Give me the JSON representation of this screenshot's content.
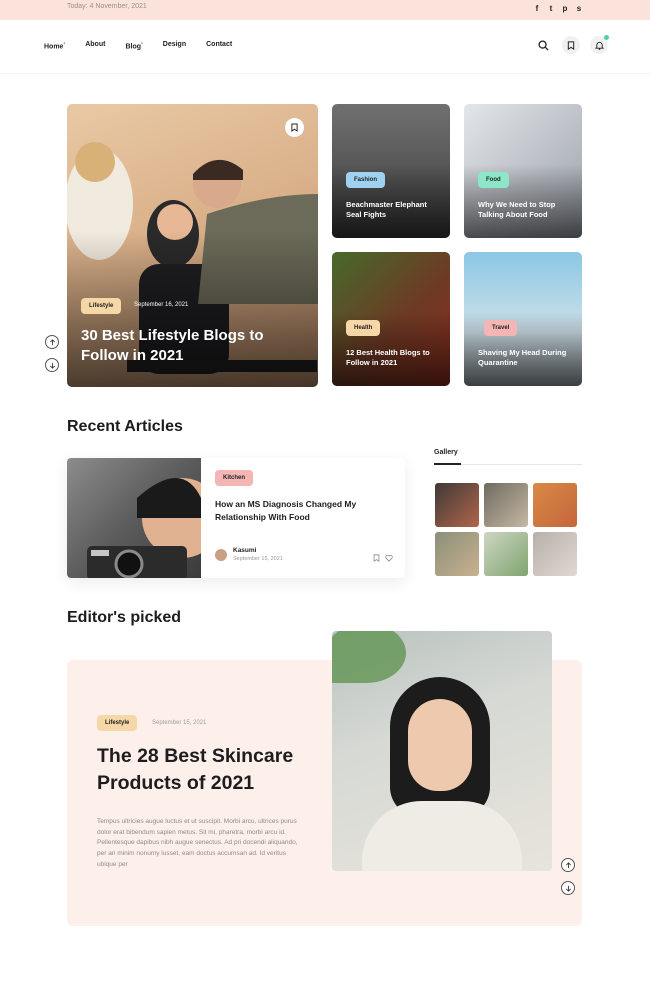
{
  "topbar": {
    "date": "Today: 4 November, 2021",
    "social": [
      "f",
      "t",
      "p",
      "s"
    ]
  },
  "nav": {
    "links": [
      {
        "label": "Home",
        "dropdown": true
      },
      {
        "label": "About",
        "dropdown": false
      },
      {
        "label": "Blog",
        "dropdown": true
      },
      {
        "label": "Design",
        "dropdown": false
      },
      {
        "label": "Contact",
        "dropdown": false
      }
    ],
    "tools": [
      "search-icon",
      "bookmark-icon",
      "bell-icon"
    ]
  },
  "hero": {
    "tag": "Lifestyle",
    "date": "September 16, 2021",
    "title": "30 Best Lifestyle Blogs to Follow in 2021"
  },
  "cards": [
    {
      "tag": "Fashion",
      "tag_color": "#9fd2f0",
      "title": "Beachmaster Elephant Seal Fights",
      "bg": [
        "#3e3e3e",
        "#6a6a6a"
      ]
    },
    {
      "tag": "Food",
      "tag_color": "#8ee6c9",
      "title": "Why We Need to Stop Talking About Food",
      "bg": [
        "#d9dde3",
        "#8a8f96"
      ]
    },
    {
      "tag": "Health",
      "tag_color": "#f6d7a7",
      "title": "12 Best Health Blogs to Follow in 2021",
      "bg": [
        "#4b6a2e",
        "#7a2a1a"
      ]
    },
    {
      "tag": "Travel",
      "tag_color": "#f4b5b5",
      "title": "Shaving My Head During Quarantine",
      "bg": [
        "#8fc9e6",
        "#d7e4ea"
      ]
    }
  ],
  "recent": {
    "heading": "Recent Articles",
    "article": {
      "tag": "Kitchen",
      "tag_color": "#f4b5b5",
      "title": "How an MS Diagnosis Changed My Relationship With Food",
      "author": "Kasumi",
      "date": "September 15, 2021"
    }
  },
  "gallery": {
    "heading": "Gallery",
    "tiles": [
      [
        "#3f3a36",
        "#b2654b"
      ],
      [
        "#6f6a60",
        "#c6b9a4"
      ],
      [
        "#d88a46",
        "#c5663c"
      ],
      [
        "#8a8f7a",
        "#c9b18e"
      ],
      [
        "#cfd6c5",
        "#7ea46e"
      ],
      [
        "#b7b0aa",
        "#e2d8d2"
      ]
    ]
  },
  "editor": {
    "heading": "Editor's picked",
    "tag": "Lifestyle",
    "date": "September 15, 2021",
    "title": "The 28 Best Skincare Products of 2021",
    "excerpt": "Tempus ultricies augue luctus et ut suscipit. Morbi arcu, ultrices purus dolor erat bibendum sapien metus. Sit mi, pharetra, morbi arcu id. Pellentesque dapibus nibh augue senectus. Ad pri docendi aliquando, per an minim nonumy lusset, eam doctus accumsan ad. Id veritus ubique per"
  }
}
